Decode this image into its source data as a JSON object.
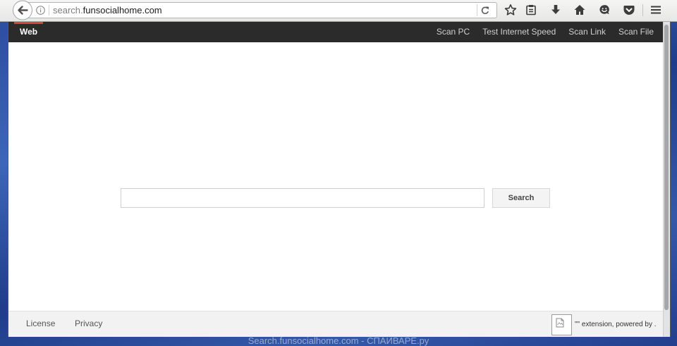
{
  "window": {
    "url_prefix": "search.",
    "url_domain": "funsocialhome.com"
  },
  "toolbar_icons": [
    "back-icon",
    "info-icon",
    "reload-icon",
    "bookmark-star-icon",
    "reading-list-icon",
    "download-icon",
    "home-icon",
    "hello-icon",
    "pocket-icon",
    "menu-icon"
  ],
  "navbar": {
    "active_tab": "Web",
    "links": [
      "Scan PC",
      "Test Internet Speed",
      "Scan Link",
      "Scan File"
    ]
  },
  "search": {
    "input_value": "",
    "button_label": "Search"
  },
  "footer": {
    "links": [
      "License",
      "Privacy"
    ],
    "extension_icon": "broken-image-icon",
    "extension_text": "\"\" extension, powered by ."
  },
  "watermark": "Search.funsocialhome.com - СПАЙВАРЕ.ру",
  "colors": {
    "navbar_bg": "#2b2b2b",
    "active_tab_accent": "#d2483c",
    "footer_bg": "#f2f2f2",
    "desktop_bg": "#2e4d9c"
  }
}
